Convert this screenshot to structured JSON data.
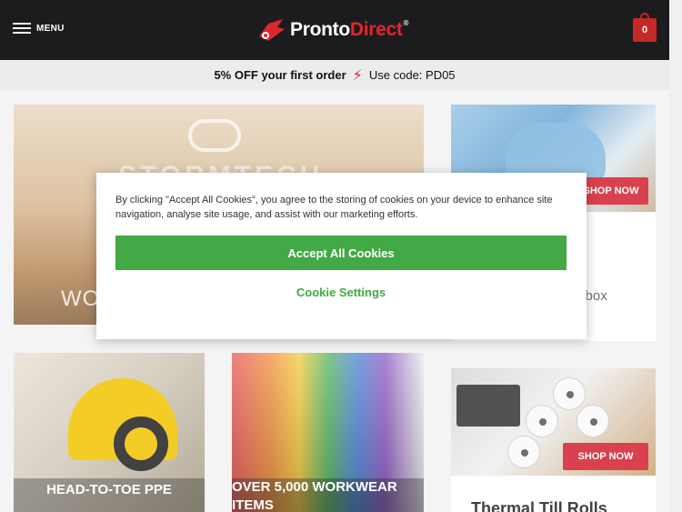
{
  "header": {
    "menu_label": "MENU",
    "logo": {
      "part1": "Pronto",
      "part2": "Direct",
      "reg": "®"
    },
    "cart_count": "0",
    "brand_color": "#e0262d"
  },
  "promo": {
    "offer": "5% OFF your first order",
    "bolt_icon": "⚡",
    "code": "Use code: PD05"
  },
  "tiles": {
    "hero": {
      "brand": "STORMTECH",
      "label": "WOR"
    },
    "card1": {
      "shop": "SHOP NOW",
      "title_fragment": "e",
      "desc_fragment": "er box"
    },
    "ppe": {
      "label": "HEAD-TO-TOE PPE"
    },
    "workwear": {
      "label": "OVER 5,000 WORKWEAR ITEMS"
    },
    "card2": {
      "shop": "SHOP NOW",
      "title": "Thermal Till Rolls"
    }
  },
  "cookie": {
    "text": "By clicking \"Accept All Cookies\", you agree to the storing of cookies on your device to enhance site navigation, analyse site usage, and assist with our marketing efforts.",
    "accept": "Accept All Cookies",
    "settings": "Cookie Settings",
    "accent": "#43a846"
  }
}
